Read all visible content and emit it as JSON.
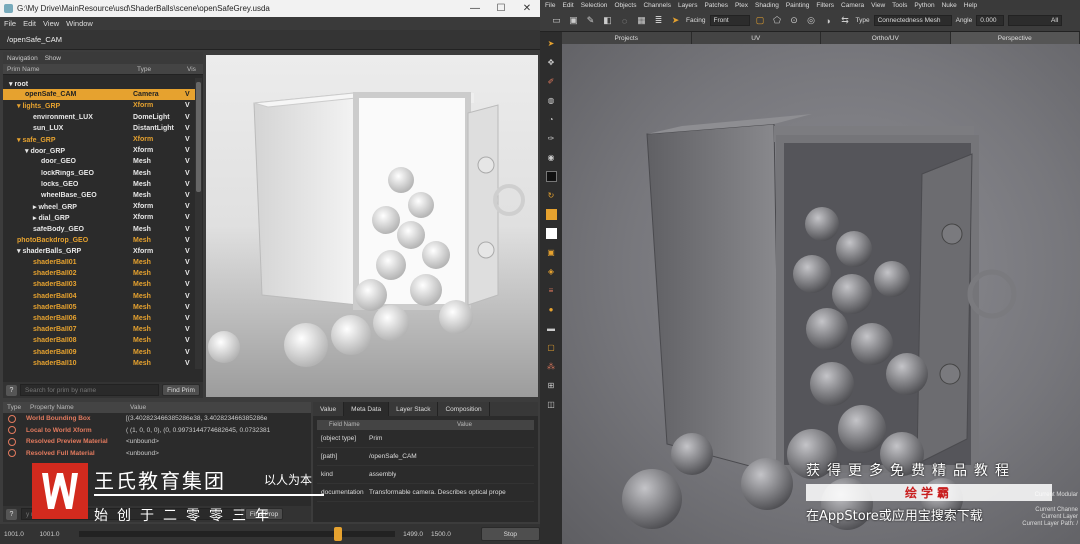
{
  "usdview": {
    "title": "G:\\My Drive\\MainResource\\usd\\ShaderBalls\\scene\\openSafeGrey.usda",
    "window_controls": [
      "—",
      "☐",
      "✕"
    ],
    "menu": [
      "File",
      "Edit",
      "View",
      "Window"
    ],
    "path": "/openSafe_CAM",
    "nav": [
      "Navigation",
      "Show"
    ],
    "tree_headers": [
      "Prim Name",
      "Type",
      "Vis"
    ],
    "tree_rows": [
      {
        "name": "▾ root",
        "type": "",
        "vis": "",
        "indent": 0,
        "color": "white"
      },
      {
        "name": "openSafe_CAM",
        "type": "Camera",
        "vis": "V",
        "indent": 2,
        "color": "sel"
      },
      {
        "name": "▾ lights_GRP",
        "type": "Xform",
        "vis": "V",
        "indent": 1,
        "color": "orange"
      },
      {
        "name": "environment_LUX",
        "type": "DomeLight",
        "vis": "V",
        "indent": 3,
        "color": "white"
      },
      {
        "name": "sun_LUX",
        "type": "DistantLight",
        "vis": "V",
        "indent": 3,
        "color": "white"
      },
      {
        "name": "▾ safe_GRP",
        "type": "Xform",
        "vis": "V",
        "indent": 1,
        "color": "orange"
      },
      {
        "name": "▾ door_GRP",
        "type": "Xform",
        "vis": "V",
        "indent": 2,
        "color": "white"
      },
      {
        "name": "door_GEO",
        "type": "Mesh",
        "vis": "V",
        "indent": 4,
        "color": "white"
      },
      {
        "name": "lockRings_GEO",
        "type": "Mesh",
        "vis": "V",
        "indent": 4,
        "color": "white"
      },
      {
        "name": "locks_GEO",
        "type": "Mesh",
        "vis": "V",
        "indent": 4,
        "color": "white"
      },
      {
        "name": "wheelBase_GEO",
        "type": "Mesh",
        "vis": "V",
        "indent": 4,
        "color": "white"
      },
      {
        "name": "▸ wheel_GRP",
        "type": "Xform",
        "vis": "V",
        "indent": 3,
        "color": "white"
      },
      {
        "name": "▸ dial_GRP",
        "type": "Xform",
        "vis": "V",
        "indent": 3,
        "color": "white"
      },
      {
        "name": "safeBody_GEO",
        "type": "Mesh",
        "vis": "V",
        "indent": 3,
        "color": "white"
      },
      {
        "name": "photoBackdrop_GEO",
        "type": "Mesh",
        "vis": "V",
        "indent": 1,
        "color": "orange"
      },
      {
        "name": "▾ shaderBalls_GRP",
        "type": "Xform",
        "vis": "V",
        "indent": 1,
        "color": "white"
      },
      {
        "name": "shaderBall01",
        "type": "Mesh",
        "vis": "V",
        "indent": 3,
        "color": "orange"
      },
      {
        "name": "shaderBall02",
        "type": "Mesh",
        "vis": "V",
        "indent": 3,
        "color": "orange"
      },
      {
        "name": "shaderBall03",
        "type": "Mesh",
        "vis": "V",
        "indent": 3,
        "color": "orange"
      },
      {
        "name": "shaderBall04",
        "type": "Mesh",
        "vis": "V",
        "indent": 3,
        "color": "orange"
      },
      {
        "name": "shaderBall05",
        "type": "Mesh",
        "vis": "V",
        "indent": 3,
        "color": "orange"
      },
      {
        "name": "shaderBall06",
        "type": "Mesh",
        "vis": "V",
        "indent": 3,
        "color": "orange"
      },
      {
        "name": "shaderBall07",
        "type": "Mesh",
        "vis": "V",
        "indent": 3,
        "color": "orange"
      },
      {
        "name": "shaderBall08",
        "type": "Mesh",
        "vis": "V",
        "indent": 3,
        "color": "orange"
      },
      {
        "name": "shaderBall09",
        "type": "Mesh",
        "vis": "V",
        "indent": 3,
        "color": "orange"
      },
      {
        "name": "shaderBall10",
        "type": "Mesh",
        "vis": "V",
        "indent": 3,
        "color": "orange"
      }
    ],
    "search_placeholder": "Search for prim by name",
    "find_prim_label": "Find Prim",
    "help_label": "?",
    "prop_headers": [
      "Type",
      "Property Name",
      "Value"
    ],
    "prop_rows": [
      {
        "name": "World Bounding Box",
        "value": "[(3.402823466385286e38, 3.402823466385286e"
      },
      {
        "name": "Local to World Xform",
        "value": "( (1, 0, 0, 0), (0, 0.9973144774682645, 0.0732381"
      },
      {
        "name": "Resolved Preview Material",
        "value": "<unbound>"
      },
      {
        "name": "Resolved Full Material",
        "value": "<unbound>"
      }
    ],
    "prop_search_placeholder": "y name",
    "find_prop_label": "Find Prop",
    "meta_tabs": [
      "Value",
      "Meta Data",
      "Layer Stack",
      "Composition"
    ],
    "meta_headers": [
      "Field Name",
      "Value"
    ],
    "meta_rows": [
      {
        "key": "[object type]",
        "value": "Prim"
      },
      {
        "key": "[path]",
        "value": "/openSafe_CAM"
      },
      {
        "key": "kind",
        "value": "assembly"
      },
      {
        "key": "documentation",
        "value": "Transformable camera. Describes optical prope"
      }
    ],
    "timeline": {
      "start": "1001.0",
      "start2": "1001.0",
      "end": "1499.0",
      "end2": "1500.0",
      "stop_label": "Stop"
    }
  },
  "mari": {
    "menu": [
      "File",
      "Edit",
      "Selection",
      "Objects",
      "Channels",
      "Layers",
      "Patches",
      "Ptex",
      "Shading",
      "Painting",
      "Filters",
      "Camera",
      "View",
      "Tools",
      "Python",
      "Nuke",
      "Help"
    ],
    "facing_label": "Facing",
    "facing_value": "Front",
    "type_label": "Type",
    "type_value": "Connectedness Mesh",
    "angle_label": "Angle",
    "angle_value": "0.000",
    "all_label": "All",
    "tabs": [
      "Projects",
      "UV",
      "Ortho/UV",
      "Perspective"
    ],
    "hud_lines": [
      "Current Modular",
      "Current Channe",
      "Current Layer",
      "Current Layer Path: /"
    ]
  },
  "overlay": {
    "brand_name": "王氏教育集团",
    "brand_motto": "以人为本",
    "brand_sub": "始创于二零零三年",
    "promo_top": "获得更多免费精品教程",
    "promo_mid": "绘学霸",
    "promo_bottom": "在AppStore或应用宝搜索下载"
  },
  "colors": {
    "accent_orange": "#e6a22f",
    "prop_red": "#e27a5e",
    "brand_red": "#d22a1e"
  }
}
